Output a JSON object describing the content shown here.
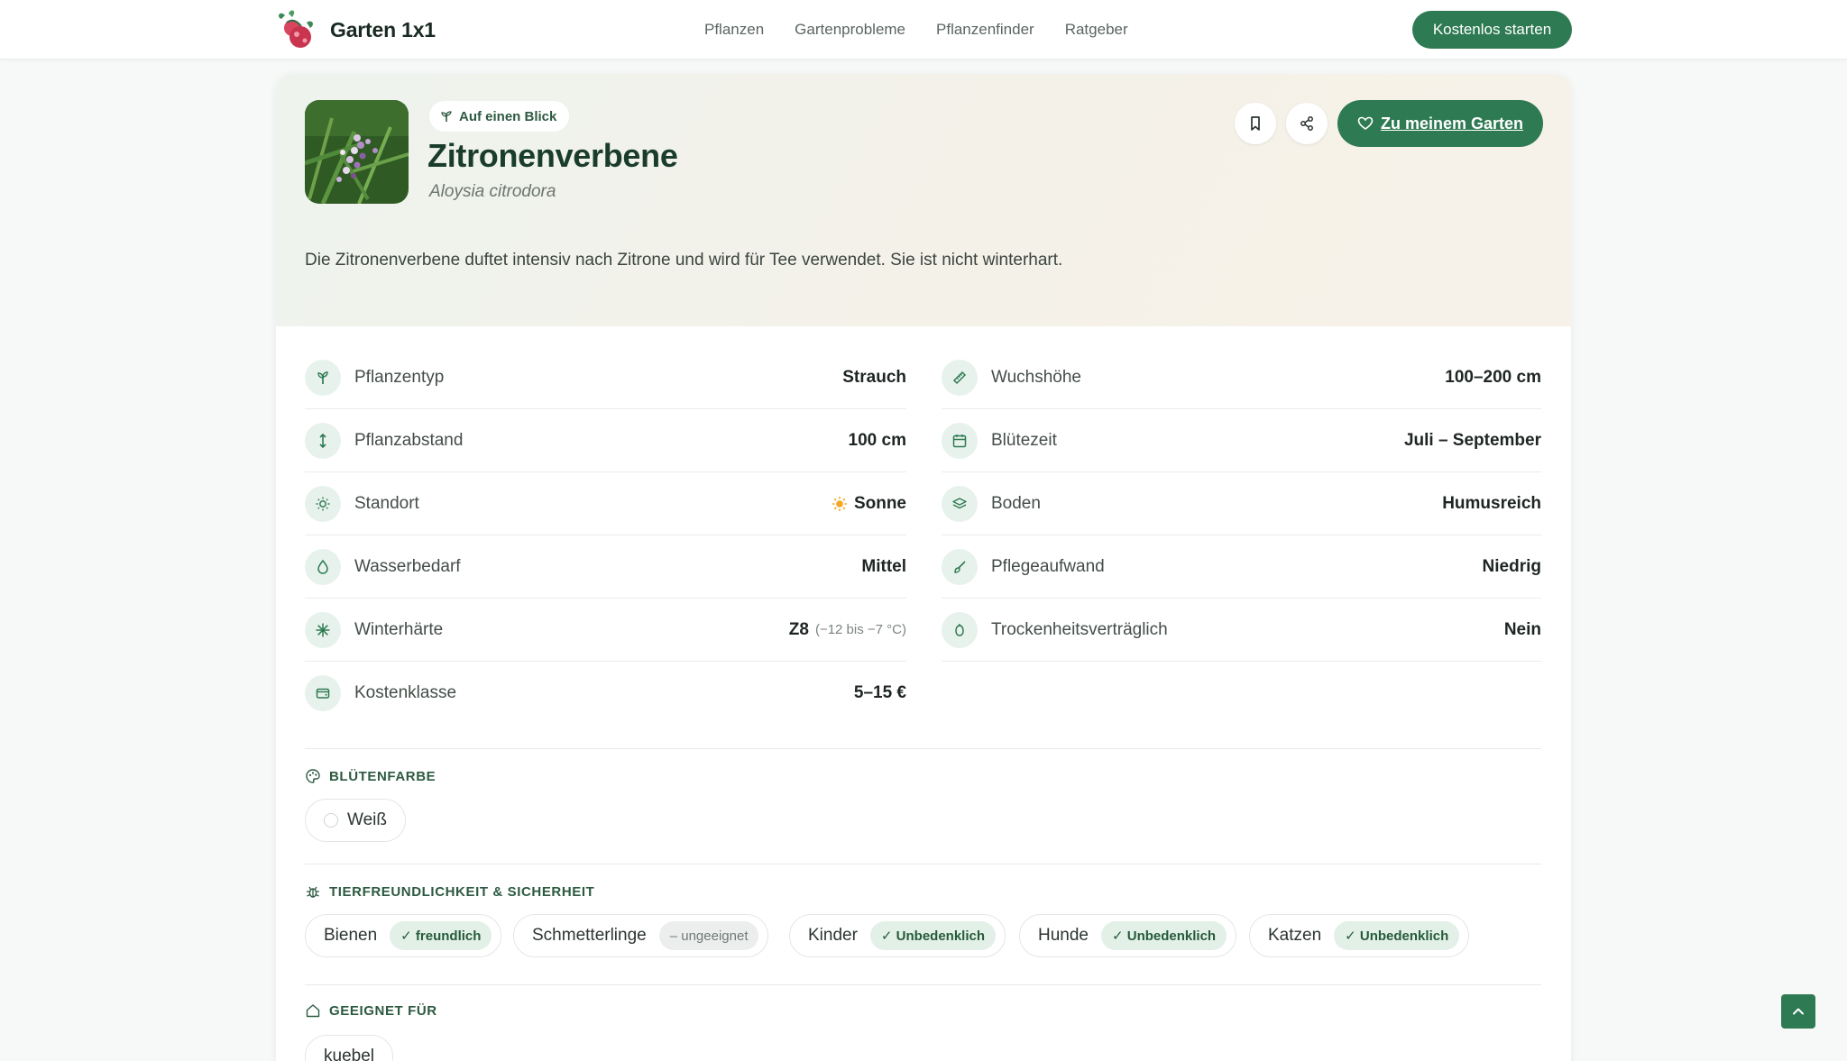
{
  "header": {
    "brand": "Garten 1x1",
    "nav": [
      "Pflanzen",
      "Gartenprobleme",
      "Pflanzenfinder",
      "Ratgeber"
    ],
    "cta": "Kostenlos starten"
  },
  "plant": {
    "badge": "Auf einen Blick",
    "name": "Zitronenverbene",
    "latin": "Aloysia citrodora",
    "description": "Die Zitronenverbene duftet intensiv nach Zitrone und wird für Tee verwendet. Sie ist nicht winterhart.",
    "add_button": "Zu meinem Garten"
  },
  "attributes_left": [
    {
      "label": "Pflanzentyp",
      "value": "Strauch",
      "icon": "sprout-icon"
    },
    {
      "label": "Pflanzabstand",
      "value": "100 cm",
      "icon": "spacing-arrows-icon"
    },
    {
      "label": "Standort",
      "value": "Sonne",
      "icon": "sun-icon"
    },
    {
      "label": "Wasserbedarf",
      "value": "Mittel",
      "icon": "water-drop-icon"
    },
    {
      "label": "Winterhärte",
      "value": "Z8",
      "sub": "(−12 bis −7 °C)",
      "icon": "snowflake-icon"
    },
    {
      "label": "Kostenklasse",
      "value": "5–15 €",
      "icon": "wallet-icon"
    }
  ],
  "attributes_right": [
    {
      "label": "Wuchshöhe",
      "value": "100–200 cm",
      "icon": "ruler-icon"
    },
    {
      "label": "Blütezeit",
      "value": "Juli – September",
      "icon": "calendar-icon"
    },
    {
      "label": "Boden",
      "value": "Humusreich",
      "icon": "layers-icon"
    },
    {
      "label": "Pflegeaufwand",
      "value": "Niedrig",
      "icon": "brush-icon"
    },
    {
      "label": "Trockenheitsverträglich",
      "value": "Nein",
      "icon": "cactus-icon"
    }
  ],
  "flower_color": {
    "title": "BLÜTENFARBE",
    "colors": [
      "Weiß"
    ]
  },
  "animal_safety": {
    "title": "TIERFREUNDLICHKEIT & SICHERHEIT",
    "items": [
      {
        "label": "Bienen",
        "status": "✓ freundlich",
        "tone": "good"
      },
      {
        "label": "Schmetterlinge",
        "status": "– ungeeignet",
        "tone": "neutral"
      },
      {
        "label": "Kinder",
        "status": "✓ Unbedenklich",
        "tone": "good"
      },
      {
        "label": "Hunde",
        "status": "✓ Unbedenklich",
        "tone": "good"
      },
      {
        "label": "Katzen",
        "status": "✓ Unbedenklich",
        "tone": "good"
      }
    ]
  },
  "suitable": {
    "title": "GEEIGNET FÜR",
    "items": [
      "kuebel"
    ]
  },
  "colors": {
    "accent": "#2e7a52",
    "accent_soft": "#e8f2ec",
    "heading": "#1a3d2b"
  }
}
